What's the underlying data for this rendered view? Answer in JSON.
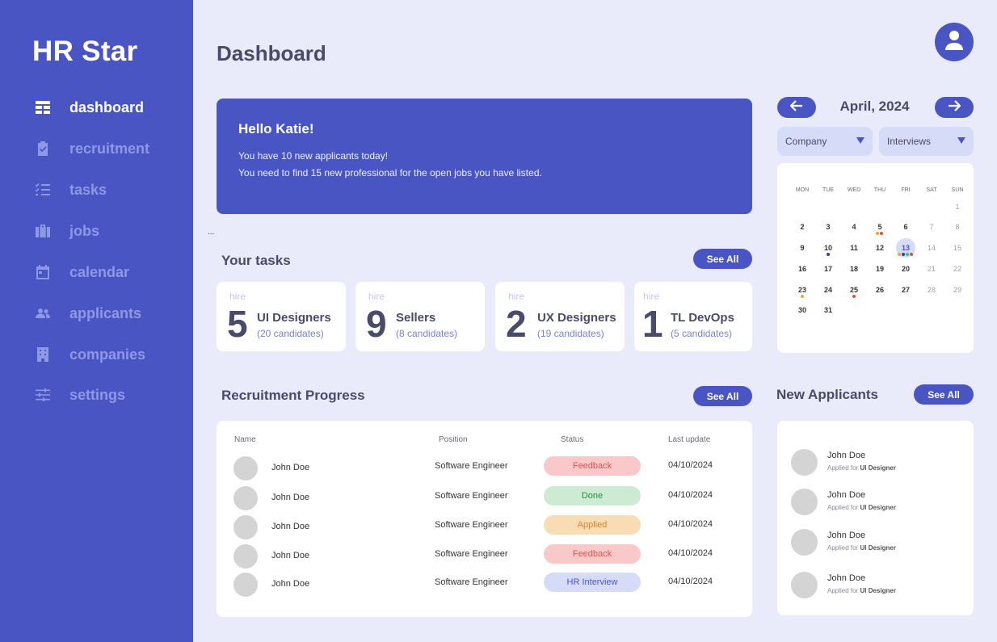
{
  "sidebar": {
    "brand": "HR Star",
    "items": [
      {
        "label": "dashboard",
        "icon": "dashboard-icon",
        "active": true
      },
      {
        "label": "recruitment",
        "icon": "clipboard-check-icon"
      },
      {
        "label": "tasks",
        "icon": "checklist-icon"
      },
      {
        "label": "jobs",
        "icon": "briefcase-icon"
      },
      {
        "label": "calendar",
        "icon": "calendar-icon"
      },
      {
        "label": "applicants",
        "icon": "people-icon"
      },
      {
        "label": "companies",
        "icon": "building-icon"
      },
      {
        "label": "settings",
        "icon": "sliders-icon"
      }
    ]
  },
  "header": {
    "title": "Dashboard",
    "avatar_icon": "user-icon"
  },
  "hello": {
    "title": "Hello Katie!",
    "line1": "You have 10 new applicants  today!",
    "line2": "You need to find 15 new professional for the open jobs you have listed."
  },
  "ellipsis": "...",
  "tasks": {
    "title": "Your tasks",
    "see_all": "See All",
    "cards": [
      {
        "tag": "hire",
        "count": "5",
        "title": "UI Designers",
        "sub": "(20 candidates)"
      },
      {
        "tag": "hire",
        "count": "9",
        "title": "Sellers",
        "sub": "(8 candidates)"
      },
      {
        "tag": "hire",
        "count": "2",
        "title": "UX Designers",
        "sub": "(19 candidates)"
      },
      {
        "tag": "hire",
        "count": "1",
        "title": "TL DevOps",
        "sub": "(5 candidates)"
      }
    ]
  },
  "calendar": {
    "month": "April, 2024",
    "filter_company": "Company",
    "filter_interviews": "Interviews",
    "weekdays": [
      "MON",
      "TUE",
      "WED",
      "THU",
      "FRI",
      "SAT",
      "SUN"
    ],
    "weeks": [
      [
        "",
        "",
        "",
        "",
        "",
        "",
        "1"
      ],
      [
        "2",
        "3",
        "4",
        "5",
        "6",
        "7",
        "8"
      ],
      [
        "9",
        "10",
        "11",
        "12",
        "13",
        "14",
        "15"
      ],
      [
        "16",
        "17",
        "18",
        "19",
        "20",
        "21",
        "22"
      ],
      [
        "23",
        "24",
        "25",
        "26",
        "27",
        "28",
        "29"
      ],
      [
        "30",
        "31",
        "",
        "",
        "",
        "",
        ""
      ]
    ],
    "today": "13",
    "event_colors": {
      "orange": "#f5a623",
      "red": "#e74c3c",
      "blue": "#2f3fbf",
      "green": "#2ecc71"
    }
  },
  "recruitment": {
    "title": "Recruitment Progress",
    "see_all": "See All",
    "headers": [
      "Name",
      "Position",
      "Status",
      "Last update"
    ],
    "rows": [
      {
        "name": "John Doe",
        "position": "Software Engineer",
        "status": "Feedback",
        "date": "04/10/2024"
      },
      {
        "name": "John Doe",
        "position": "Software Engineer",
        "status": "Done",
        "date": "04/10/2024"
      },
      {
        "name": "John Doe",
        "position": "Software Engineer",
        "status": "Applied",
        "date": "04/10/2024"
      },
      {
        "name": "John Doe",
        "position": "Software Engineer",
        "status": "Feedback",
        "date": "04/10/2024"
      },
      {
        "name": "John Doe",
        "position": "Software Engineer",
        "status": "HR Interview",
        "date": "04/10/2024"
      }
    ],
    "status_colors": {
      "Feedback": {
        "bg": "#f9c9c9",
        "fg": "#d9534f"
      },
      "Done": {
        "bg": "#cdebd3",
        "fg": "#2e8b3e"
      },
      "Applied": {
        "bg": "#f8dcb4",
        "fg": "#d9822b"
      },
      "HR Interview": {
        "bg": "#d6dbf8",
        "fg": "#4a55c4"
      }
    }
  },
  "applicants": {
    "title": "New Applicants",
    "see_all": "See All",
    "items": [
      {
        "name": "John Doe",
        "prefix": "Applied for",
        "role": "UI Designer"
      },
      {
        "name": "John Doe",
        "prefix": "Applied for",
        "role": "UI Designer"
      },
      {
        "name": "John Doe",
        "prefix": "Applied for",
        "role": "UI Designer"
      },
      {
        "name": "John Doe",
        "prefix": "Applied for",
        "role": "UI Designer"
      }
    ]
  }
}
